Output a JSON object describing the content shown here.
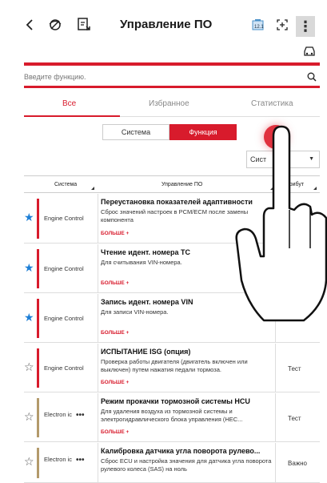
{
  "header": {
    "title": "Управление ПО",
    "back_icon": "chevron-left-icon",
    "connection_icon": "vci-connection-icon",
    "report_icon": "report-icon",
    "battery_icon": "battery-icon",
    "screen_icon": "fullscreen-icon",
    "menu_icon": "kebab-menu-icon",
    "vehicle_icon": "car-icon"
  },
  "search": {
    "placeholder": "Введите функцию."
  },
  "tabs": [
    {
      "label": "Все",
      "active": true
    },
    {
      "label": "Избранное",
      "active": false
    },
    {
      "label": "Статистика",
      "active": false
    }
  ],
  "segments": [
    {
      "label": "Система",
      "active": false
    },
    {
      "label": "Функция",
      "active": true
    }
  ],
  "dropdown": {
    "value": "Сист"
  },
  "table": {
    "columns": [
      "Система",
      "Управление ПО",
      "Атрибут"
    ],
    "more_label": "БОЛЬШЕ +",
    "rows": [
      {
        "favorite": true,
        "system": "Engine Control",
        "name": "Переустановка показателей адаптивности",
        "desc": "Сброс значений настроек в PCM/ECM после замены компонента",
        "attr": ""
      },
      {
        "favorite": true,
        "system": "Engine Control",
        "name": "Чтение идент. номера ТС",
        "desc": "Для считывания VIN-номера.",
        "attr": ""
      },
      {
        "favorite": true,
        "system": "Engine Control",
        "name": "Запись идент. номера VIN",
        "desc": "Для записи VIN-номера.",
        "attr": ""
      },
      {
        "favorite": false,
        "system": "Engine Control",
        "name": "ИСПЫТАНИЕ ISG (опция)",
        "desc": "Проверка работы двигателя (двигатель включен или выключен) путем нажатия педали тормоза.",
        "attr": "Тест"
      },
      {
        "favorite": false,
        "system": "Electron ic",
        "name": "Режим прокачки тормозной системы HCU",
        "desc": "Для удаления воздуха из тормозной системы и электрогидравлического блока управления (HEC...",
        "attr": "Тест"
      },
      {
        "favorite": false,
        "system": "Electron ic",
        "name": "Калибровка датчика угла поворота рулево...",
        "desc": "Сброс ECU и настройка значения для датчика угла поворота рулевого колеса (SAS) на ноль",
        "attr": "Важно"
      }
    ]
  },
  "colors": {
    "accent": "#d81b2c",
    "favorite_star": "#1e7fd6",
    "system_bar_engine": "#d81b2c",
    "system_bar_electronic": "#b39a6b"
  }
}
